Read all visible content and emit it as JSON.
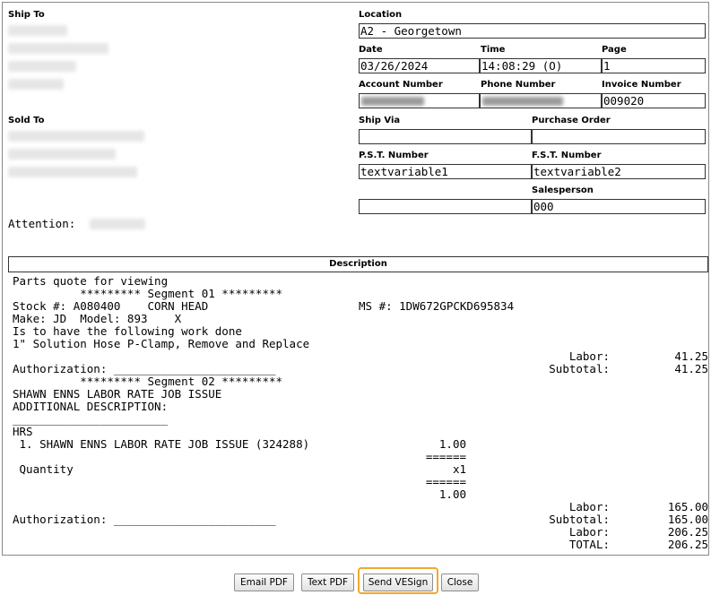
{
  "header": {
    "ship_to_label": "Ship To",
    "sold_to_label": "Sold To",
    "attention_label": "Attention:",
    "location_label": "Location",
    "location_value": "A2 - Georgetown",
    "date_label": "Date",
    "date_value": "03/26/2024",
    "time_label": "Time",
    "time_value": "14:08:29 (O)",
    "page_label": "Page",
    "page_value": "1",
    "account_label": "Account Number",
    "account_value": "",
    "phone_label": "Phone Number",
    "phone_value": "",
    "invoice_label": "Invoice Number",
    "invoice_value": "009020",
    "ship_via_label": "Ship Via",
    "ship_via_value": "",
    "po_label": "Purchase Order",
    "po_value": "",
    "pst_label": "P.S.T. Number",
    "pst_value": "textvariable1",
    "fst_label": "F.S.T. Number",
    "fst_value": "textvariable2",
    "salesperson_label": "Salesperson",
    "salesperson_left_value": "",
    "salesperson_value": "000"
  },
  "description": {
    "heading": "Description",
    "lines": [
      "Parts quote for viewing",
      "          ********* Segment 01 *********",
      "Stock #: A080400    CORN HEAD",
      "Make: JD  Model: 893    X",
      "Is to have the following work done",
      "1\" Solution Hose P-Clamp, Remove and Replace",
      "Authorization: ________________________",
      "          ********* Segment 02 *********",
      "SHAWN ENNS LABOR RATE JOB ISSUE",
      "ADDITIONAL DESCRIPTION:",
      "_______________________",
      "HRS",
      " 1. SHAWN ENNS LABOR RATE JOB ISSUE (324288)",
      " Quantity",
      "Authorization: ________________________"
    ],
    "ms_number": "MS #: 1DW672GPCKD695834",
    "seg1_totals": [
      {
        "label": "Labor:",
        "value": "41.25"
      },
      {
        "label": "Subtotal:",
        "value": "41.25"
      }
    ],
    "qty_column": [
      "1.00",
      "======",
      "x1",
      "======",
      "1.00"
    ],
    "seg2_totals": [
      {
        "label": "Labor:",
        "value": "165.00"
      },
      {
        "label": "Subtotal:",
        "value": "165.00"
      },
      {
        "label": "Labor:",
        "value": "206.25"
      },
      {
        "label": "TOTAL:",
        "value": "206.25"
      }
    ]
  },
  "buttons": {
    "email_pdf": "Email PDF",
    "text_pdf": "Text PDF",
    "send_vesign": "Send VESign",
    "close": "Close"
  },
  "colors": {
    "highlight": "#f0a830",
    "border": "#333333",
    "redacted": "#e6e6e6"
  }
}
